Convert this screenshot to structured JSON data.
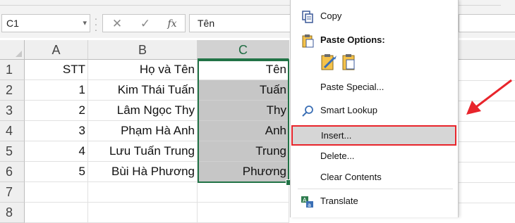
{
  "formula_bar": {
    "name_box": "C1",
    "formula_value": "Tên",
    "cancel_glyph": "✕",
    "enter_glyph": "✓",
    "fx_glyph": "fx"
  },
  "columns": [
    "A",
    "B",
    "C"
  ],
  "rows": [
    {
      "num": "1",
      "a": "STT",
      "b": "Họ và Tên",
      "c": "Tên"
    },
    {
      "num": "2",
      "a": "1",
      "b": "Kim Thái Tuấn",
      "c": "Tuấn"
    },
    {
      "num": "3",
      "a": "2",
      "b": "Lâm Ngọc Thy",
      "c": "Thy"
    },
    {
      "num": "4",
      "a": "3",
      "b": "Phạm Hà Anh",
      "c": "Anh"
    },
    {
      "num": "5",
      "a": "4",
      "b": "Lưu Tuấn Trung",
      "c": "Trung"
    },
    {
      "num": "6",
      "a": "5",
      "b": "Bùi Hà Phương",
      "c": "Phương"
    },
    {
      "num": "7",
      "a": "",
      "b": "",
      "c": ""
    },
    {
      "num": "8",
      "a": "",
      "b": "",
      "c": ""
    }
  ],
  "context_menu": {
    "copy": "Copy",
    "paste_options": "Paste Options:",
    "paste_special": "Paste Special...",
    "smart_lookup": "Smart Lookup",
    "insert": "Insert...",
    "delete": "Delete...",
    "clear_contents": "Clear Contents",
    "translate": "Translate"
  },
  "colors": {
    "selection_green": "#217346",
    "highlight_red": "#e8242b",
    "selected_fill": "#c6c6c6"
  }
}
